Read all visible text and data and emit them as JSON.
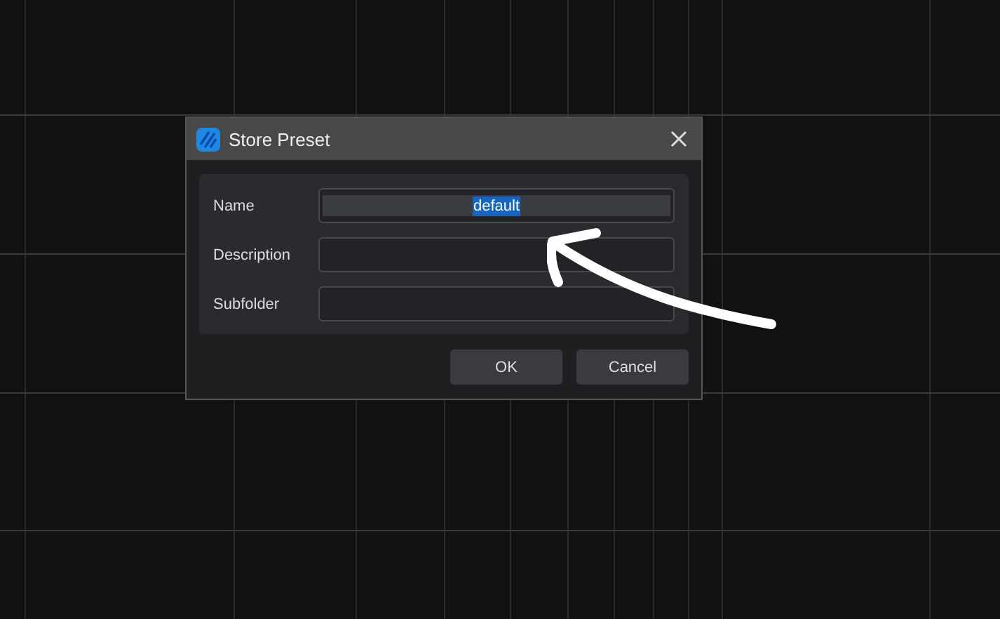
{
  "dialog": {
    "title": "Store Preset",
    "fields": [
      {
        "label": "Name",
        "value": "default",
        "text_selected": true
      },
      {
        "label": "Description"
      },
      {
        "label": "Subfolder"
      }
    ],
    "buttons": [
      "OK",
      "Cancel"
    ]
  }
}
